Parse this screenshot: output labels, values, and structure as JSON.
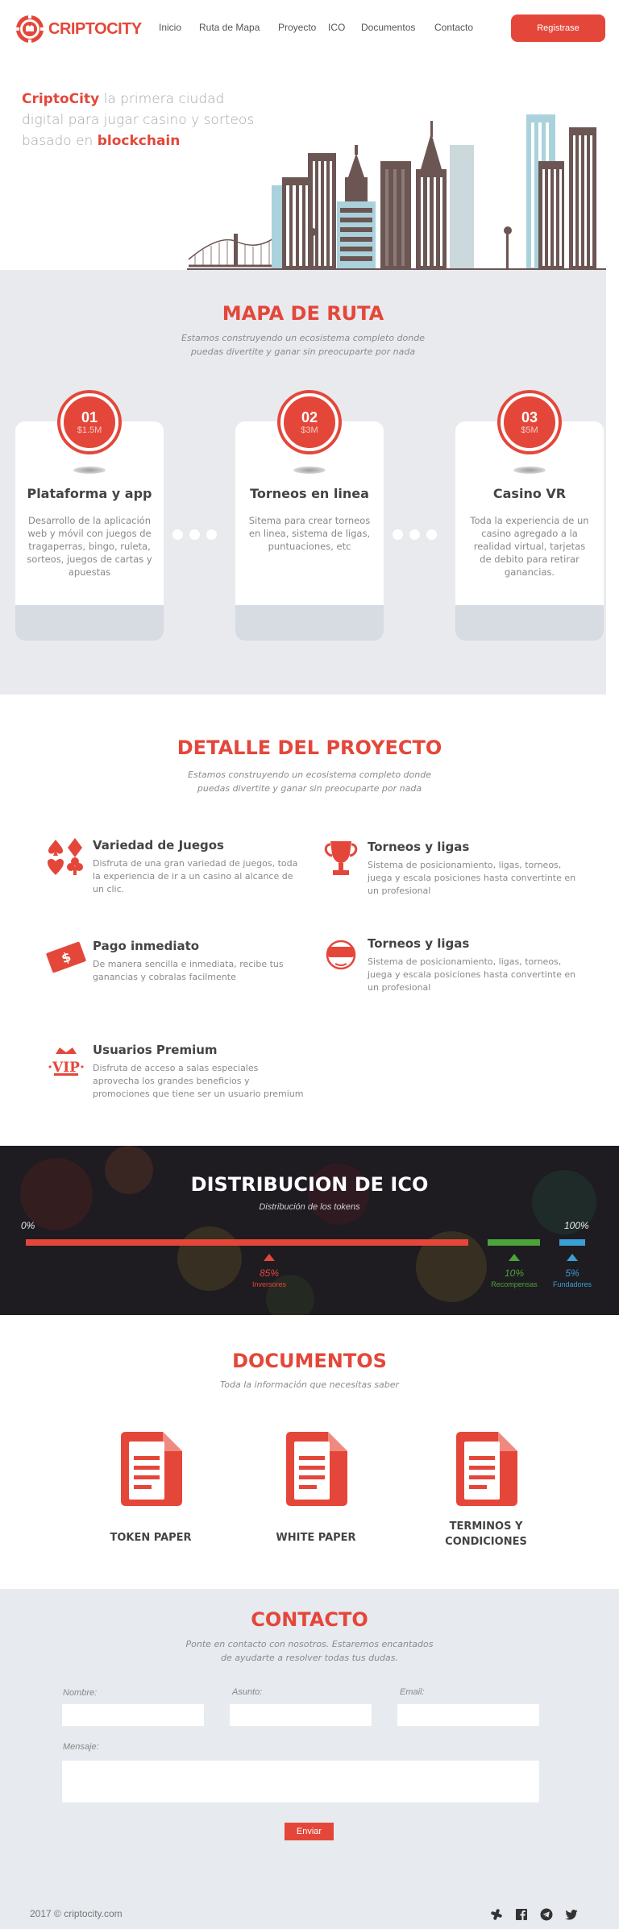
{
  "header": {
    "logo_text": "CRIPTOCITY",
    "nav": [
      "Inicio",
      "Ruta de Mapa",
      "Proyecto",
      "ICO",
      "Documentos",
      "Contacto"
    ],
    "register_label": "Registrase"
  },
  "hero": {
    "brand": "CriptoCity",
    "text_a": " la primera ciudad digital para jugar casino y sorteos basado en ",
    "highlight": "blockchain"
  },
  "roadmap": {
    "title": "MAPA DE RUTA",
    "subtitle_1": "Estamos construyendo un ecosistema completo donde",
    "subtitle_2": "puedas divertite y ganar sin preocuparte por nada",
    "items": [
      {
        "num": "01",
        "amount": "$1.5M",
        "name": "Plataforma y app",
        "desc": "Desarrollo de la aplicación web y móvil con juegos de tragaperras, bingo, ruleta, sorteos, juegos de cartas y apuestas"
      },
      {
        "num": "02",
        "amount": "$3M",
        "name": "Torneos en linea",
        "desc": "Sitema para crear torneos en linea, sistema de ligas, puntuaciones, etc"
      },
      {
        "num": "03",
        "amount": "$5M",
        "name": "Casino VR",
        "desc": "Toda la experiencia de un casino agregado a la realidad virtual, tarjetas de debito para retirar ganancias."
      }
    ]
  },
  "project": {
    "title": "DETALLE DEL PROYECTO",
    "subtitle_1": "Estamos construyendo un ecosistema completo donde",
    "subtitle_2": "puedas divertite y ganar sin preocuparte por nada",
    "features": [
      {
        "icon": "card-suits-icon",
        "title": "Variedad de Juegos",
        "desc": "Disfruta de una gran variedad de juegos, toda la experiencia de ir a un casino al alcance de un clic."
      },
      {
        "icon": "trophy-icon",
        "title": "Torneos y ligas",
        "desc": "Sistema de posicionamiento, ligas, torneos, juega y escala posiciones hasta convertinte en un profesional"
      },
      {
        "icon": "money-icon",
        "title": "Pago inmediato",
        "desc": "De manera sencilla e inmediata, recibe tus ganancias y cobralas facilmente"
      },
      {
        "icon": "vr-headset-icon",
        "title": "Torneos y ligas",
        "desc": "Sistema de posicionamiento, ligas, torneos, juega y escala posiciones hasta convertinte en un profesional"
      },
      {
        "icon": "vip-crown-icon",
        "title": "Usuarios Premium",
        "desc": "Disfruta de acceso a salas especiales  aprovecha los grandes beneficios y promociones que tiene ser un usuario premium"
      }
    ]
  },
  "ico": {
    "title": "DISTRIBUCION DE ICO",
    "subtitle": "Distribución de los tokens",
    "start_label": "0%",
    "end_label": "100%",
    "segments": [
      {
        "share": 85,
        "pct_label": "85%",
        "caption": "Inversores",
        "color": "#e4473a"
      },
      {
        "share": 10,
        "pct_label": "10%",
        "caption": "Recompensas",
        "color": "#4ca33a"
      },
      {
        "share": 5,
        "pct_label": "5%",
        "caption": "Fundadores",
        "color": "#3a9fd5"
      }
    ]
  },
  "documents": {
    "title": "DOCUMENTOS",
    "subtitle": "Toda la información que necesitas saber",
    "items": [
      "TOKEN PAPER",
      "WHITE PAPER",
      "TERMINOS Y CONDICIONES"
    ]
  },
  "contact": {
    "title": "CONTACTO",
    "subtitle_1": "Ponte en contacto con nosotros. Estaremos encantados",
    "subtitle_2": "de ayudarte a resolver todas tus dudas.",
    "name_label": "Nombre:",
    "subject_label": "Asunto:",
    "email_label": "Email:",
    "message_label": "Mensaje:",
    "send_label": "Enviar"
  },
  "footer": {
    "copyright": "2017 © criptocity.com",
    "social": [
      "slack-icon",
      "facebook-icon",
      "telegram-icon",
      "twitter-icon"
    ]
  },
  "colors": {
    "accent": "#e4473a",
    "section_bg": "#e8eaee",
    "text": "#6b6b6b"
  }
}
